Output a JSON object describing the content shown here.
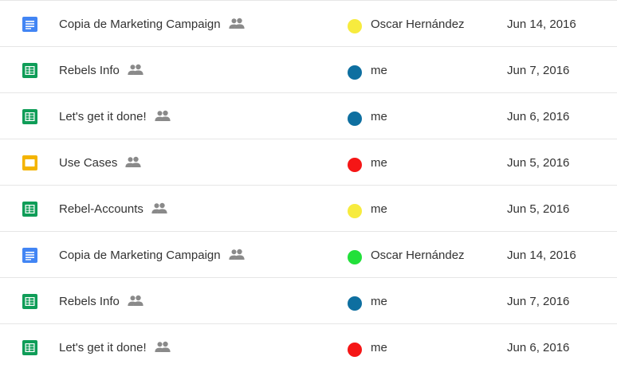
{
  "files": [
    {
      "name": "Copia de Marketing Campaign",
      "type": "docs",
      "type_icon": "docs-icon",
      "shared": true,
      "owner": "Oscar Hernández",
      "owner_color": "#f7eb3e",
      "date": "Jun 14, 2016"
    },
    {
      "name": "Rebels Info",
      "type": "sheets",
      "type_icon": "sheets-icon",
      "shared": true,
      "owner": "me",
      "owner_color": "#0e6fa0",
      "date": "Jun 7, 2016"
    },
    {
      "name": "Let's get it done!",
      "type": "sheets",
      "type_icon": "sheets-icon",
      "shared": true,
      "owner": "me",
      "owner_color": "#0e6fa0",
      "date": "Jun 6, 2016"
    },
    {
      "name": "Use Cases",
      "type": "slides",
      "type_icon": "slides-icon",
      "shared": true,
      "owner": "me",
      "owner_color": "#f51616",
      "date": "Jun 5, 2016"
    },
    {
      "name": "Rebel-Accounts",
      "type": "sheets",
      "type_icon": "sheets-icon",
      "shared": true,
      "owner": "me",
      "owner_color": "#f7eb3e",
      "date": "Jun 5, 2016"
    },
    {
      "name": "Copia de Marketing Campaign",
      "type": "docs",
      "type_icon": "docs-icon",
      "shared": true,
      "owner": "Oscar Hernández",
      "owner_color": "#22e03a",
      "date": "Jun 14, 2016"
    },
    {
      "name": "Rebels Info",
      "type": "sheets",
      "type_icon": "sheets-icon",
      "shared": true,
      "owner": "me",
      "owner_color": "#0e6fa0",
      "date": "Jun 7, 2016"
    },
    {
      "name": "Let's get it done!",
      "type": "sheets",
      "type_icon": "sheets-icon",
      "shared": true,
      "owner": "me",
      "owner_color": "#f51616",
      "date": "Jun 6, 2016"
    }
  ],
  "colors": {
    "docs": "#4285f4",
    "sheets": "#0f9d58",
    "slides": "#f4b400",
    "shared_icon": "#8a8a8a",
    "row_border": "#e6e6e6"
  },
  "shared_icon": "people-icon"
}
